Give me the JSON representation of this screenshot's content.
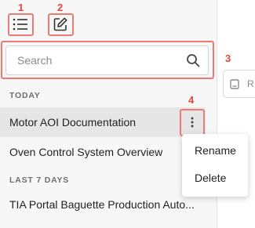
{
  "callouts": [
    "1",
    "2",
    "3",
    "4"
  ],
  "toolbar": {
    "list_icon": "list-icon",
    "new_chat_icon": "edit-icon"
  },
  "search": {
    "placeholder": "Search",
    "icon": "search-icon"
  },
  "sections": [
    {
      "title": "TODAY",
      "items": [
        {
          "label": "Motor AOI Documentation"
        },
        {
          "label": "Oven Control System Overview"
        }
      ]
    },
    {
      "title": "LAST 7 DAYS",
      "items": [
        {
          "label": "TIA Portal Baguette Production Auto..."
        }
      ]
    }
  ],
  "context_menu": {
    "items": [
      "Rename",
      "Delete"
    ]
  },
  "right_panel": {
    "chip_text": "R"
  },
  "colors": {
    "callout": "#e5453b",
    "sidebar_bg": "#f7f7f7",
    "active_item_bg": "#e6e6e6"
  }
}
